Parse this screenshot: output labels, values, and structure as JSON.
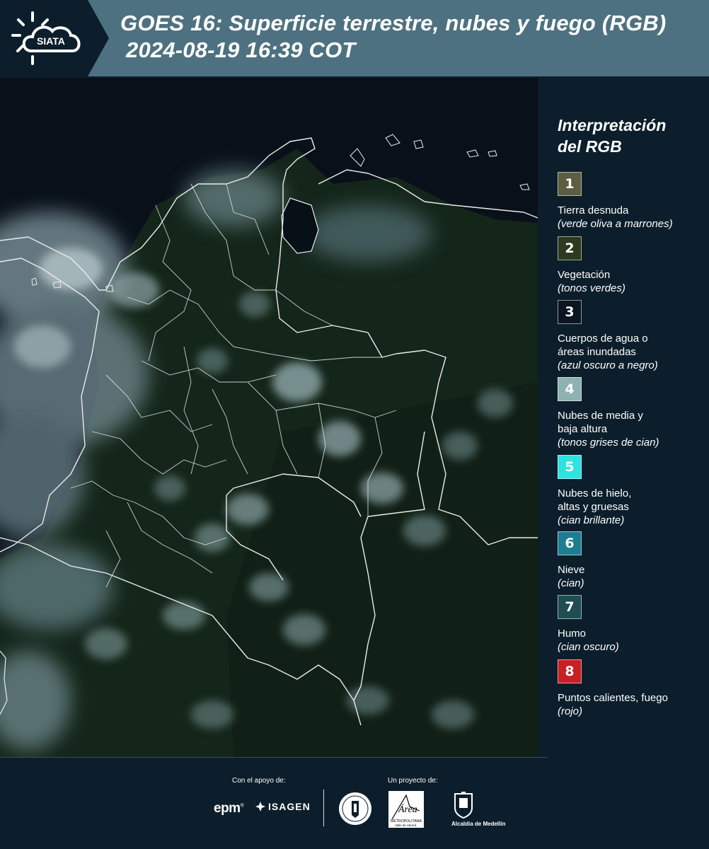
{
  "header": {
    "title": "GOES 16: Superficie terrestre, nubes y fuego (RGB)",
    "timestamp": "2024-08-19 16:39 COT",
    "logo_text": "SIATA"
  },
  "legend": {
    "title_line1": "Interpretación",
    "title_line2": "del RGB",
    "items": [
      {
        "number": "1",
        "label": "Tierra desnuda",
        "sub": "(verde oliva a marrones)",
        "color": "#5c5d42"
      },
      {
        "number": "2",
        "label": "Vegetación",
        "sub": "(tonos verdes)",
        "color": "#2d3a1f"
      },
      {
        "number": "3",
        "label": "Cuerpos de agua o áreas inundadas",
        "sub": "(azul oscuro a negro)",
        "color": "#0b1620"
      },
      {
        "number": "4",
        "label": "Nubes de media y baja altura",
        "sub": "(tonos grises de cian)",
        "color": "#8eb1b1"
      },
      {
        "number": "5",
        "label": "Nubes de hielo, altas y gruesas",
        "sub": "(cian brillante)",
        "color": "#2ee2e0"
      },
      {
        "number": "6",
        "label": "Nieve",
        "sub": "(cian)",
        "color": "#1d7e91"
      },
      {
        "number": "7",
        "label": "Humo",
        "sub": "(cian oscuro)",
        "color": "#1e4d52"
      },
      {
        "number": "8",
        "label": "Puntos calientes, fuego",
        "sub": "(rojo)",
        "color": "#c62026"
      }
    ]
  },
  "footer": {
    "support_caption": "Con el apoyo de:",
    "project_caption": "Un proyecto de:",
    "epm": "epm",
    "isagen": "ISAGEN",
    "area_line1": "Área",
    "area_line2": "METROPOLITANA",
    "area_line3": "Valle de Aburrá",
    "alcaldia": "Alcaldía de Medellín"
  },
  "colors": {
    "header_bg": "#4d7180",
    "page_bg": "#0c1e2b",
    "map_land": "#16291c",
    "map_cloud": "#9ab7bb"
  }
}
